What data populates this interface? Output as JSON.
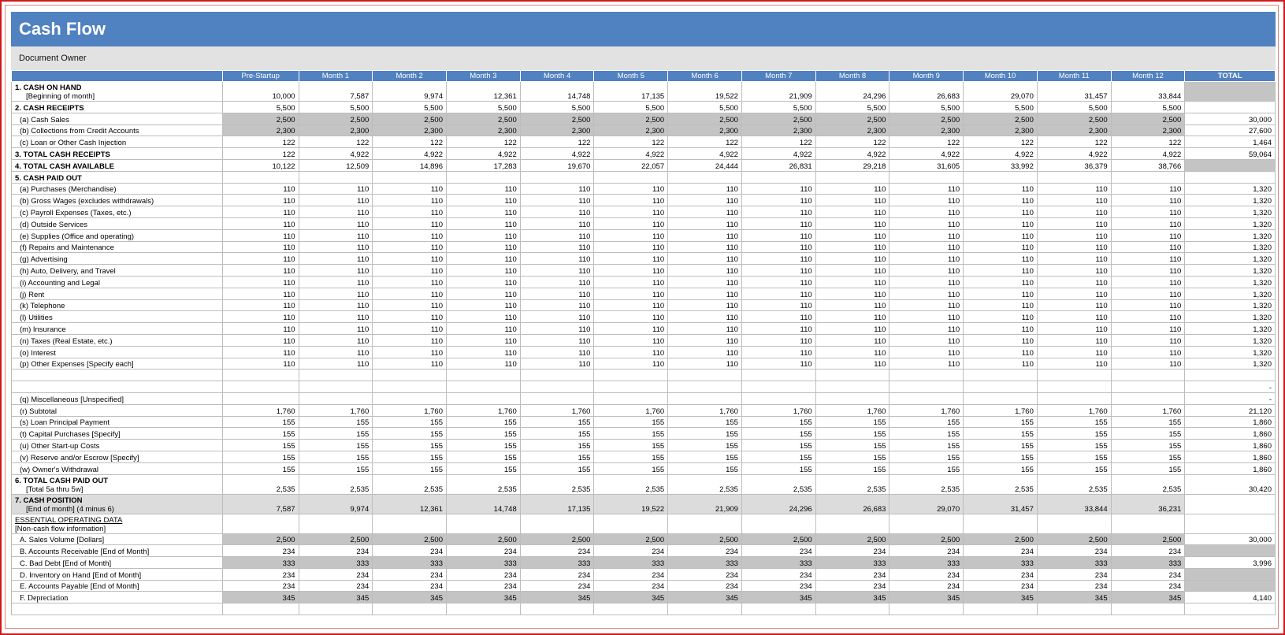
{
  "title": "Cash Flow",
  "owner": "Document Owner",
  "columns": [
    "",
    "Pre-Startup",
    "Month 1",
    "Month 2",
    "Month 3",
    "Month 4",
    "Month 5",
    "Month 6",
    "Month 7",
    "Month 8",
    "Month 9",
    "Month 10",
    "Month 11",
    "Month 12",
    "TOTAL"
  ],
  "rows": [
    {
      "l1": "1. CASH ON HAND",
      "l2": "[Beginning of month]",
      "type": "tall",
      "v": [
        "10,000",
        "7,587",
        "9,974",
        "12,361",
        "14,748",
        "17,135",
        "19,522",
        "21,909",
        "24,296",
        "26,683",
        "29,070",
        "31,457",
        "33,844"
      ],
      "t": "",
      "tgray": true
    },
    {
      "label": "2. CASH RECEIPTS",
      "type": "bold",
      "v": [
        "5,500",
        "5,500",
        "5,500",
        "5,500",
        "5,500",
        "5,500",
        "5,500",
        "5,500",
        "5,500",
        "5,500",
        "5,500",
        "5,500",
        "5,500"
      ],
      "t": ""
    },
    {
      "label": "(a) Cash Sales",
      "type": "shade",
      "ind": true,
      "v": [
        "2,500",
        "2,500",
        "2,500",
        "2,500",
        "2,500",
        "2,500",
        "2,500",
        "2,500",
        "2,500",
        "2,500",
        "2,500",
        "2,500",
        "2,500"
      ],
      "t": "30,000"
    },
    {
      "label": "(b) Collections from Credit Accounts",
      "type": "shade",
      "ind": true,
      "v": [
        "2,300",
        "2,300",
        "2,300",
        "2,300",
        "2,300",
        "2,300",
        "2,300",
        "2,300",
        "2,300",
        "2,300",
        "2,300",
        "2,300",
        "2,300"
      ],
      "t": "27,600"
    },
    {
      "label": "(c) Loan or Other Cash Injection",
      "ind": true,
      "v": [
        "122",
        "122",
        "122",
        "122",
        "122",
        "122",
        "122",
        "122",
        "122",
        "122",
        "122",
        "122",
        "122"
      ],
      "t": "1,464"
    },
    {
      "label": "3. TOTAL CASH RECEIPTS",
      "type": "bold",
      "v": [
        "122",
        "4,922",
        "4,922",
        "4,922",
        "4,922",
        "4,922",
        "4,922",
        "4,922",
        "4,922",
        "4,922",
        "4,922",
        "4,922",
        "4,922"
      ],
      "t": "59,064"
    },
    {
      "label": "4. TOTAL CASH AVAILABLE",
      "type": "bold",
      "v": [
        "10,122",
        "12,509",
        "14,896",
        "17,283",
        "19,670",
        "22,057",
        "24,444",
        "26,831",
        "29,218",
        "31,605",
        "33,992",
        "36,379",
        "38,766"
      ],
      "t": "",
      "tgray": true
    },
    {
      "label": "5. CASH PAID OUT",
      "type": "bold",
      "v": [
        "",
        "",
        "",
        "",
        "",
        "",
        "",
        "",
        "",
        "",
        "",
        "",
        ""
      ],
      "t": ""
    },
    {
      "label": "(a) Purchases (Merchandise)",
      "ind": true,
      "v": [
        "110",
        "110",
        "110",
        "110",
        "110",
        "110",
        "110",
        "110",
        "110",
        "110",
        "110",
        "110",
        "110"
      ],
      "t": "1,320"
    },
    {
      "label": "(b) Gross Wages (excludes withdrawals)",
      "ind": true,
      "v": [
        "110",
        "110",
        "110",
        "110",
        "110",
        "110",
        "110",
        "110",
        "110",
        "110",
        "110",
        "110",
        "110"
      ],
      "t": "1,320"
    },
    {
      "label": "(c) Payroll Expenses (Taxes, etc.)",
      "ind": true,
      "v": [
        "110",
        "110",
        "110",
        "110",
        "110",
        "110",
        "110",
        "110",
        "110",
        "110",
        "110",
        "110",
        "110"
      ],
      "t": "1,320"
    },
    {
      "label": "(d) Outside Services",
      "ind": true,
      "v": [
        "110",
        "110",
        "110",
        "110",
        "110",
        "110",
        "110",
        "110",
        "110",
        "110",
        "110",
        "110",
        "110"
      ],
      "t": "1,320"
    },
    {
      "label": "(e) Supplies (Office and operating)",
      "ind": true,
      "v": [
        "110",
        "110",
        "110",
        "110",
        "110",
        "110",
        "110",
        "110",
        "110",
        "110",
        "110",
        "110",
        "110"
      ],
      "t": "1,320"
    },
    {
      "label": "(f) Repairs and Maintenance",
      "ind": true,
      "v": [
        "110",
        "110",
        "110",
        "110",
        "110",
        "110",
        "110",
        "110",
        "110",
        "110",
        "110",
        "110",
        "110"
      ],
      "t": "1,320"
    },
    {
      "label": "(g) Advertising",
      "ind": true,
      "v": [
        "110",
        "110",
        "110",
        "110",
        "110",
        "110",
        "110",
        "110",
        "110",
        "110",
        "110",
        "110",
        "110"
      ],
      "t": "1,320"
    },
    {
      "label": "(h) Auto, Delivery, and Travel",
      "ind": true,
      "v": [
        "110",
        "110",
        "110",
        "110",
        "110",
        "110",
        "110",
        "110",
        "110",
        "110",
        "110",
        "110",
        "110"
      ],
      "t": "1,320"
    },
    {
      "label": "(i) Accounting and Legal",
      "ind": true,
      "v": [
        "110",
        "110",
        "110",
        "110",
        "110",
        "110",
        "110",
        "110",
        "110",
        "110",
        "110",
        "110",
        "110"
      ],
      "t": "1,320"
    },
    {
      "label": "(j) Rent",
      "ind": true,
      "v": [
        "110",
        "110",
        "110",
        "110",
        "110",
        "110",
        "110",
        "110",
        "110",
        "110",
        "110",
        "110",
        "110"
      ],
      "t": "1,320"
    },
    {
      "label": "(k) Telephone",
      "ind": true,
      "v": [
        "110",
        "110",
        "110",
        "110",
        "110",
        "110",
        "110",
        "110",
        "110",
        "110",
        "110",
        "110",
        "110"
      ],
      "t": "1,320"
    },
    {
      "label": "(l) Utilities",
      "ind": true,
      "v": [
        "110",
        "110",
        "110",
        "110",
        "110",
        "110",
        "110",
        "110",
        "110",
        "110",
        "110",
        "110",
        "110"
      ],
      "t": "1,320"
    },
    {
      "label": "(m) Insurance",
      "ind": true,
      "v": [
        "110",
        "110",
        "110",
        "110",
        "110",
        "110",
        "110",
        "110",
        "110",
        "110",
        "110",
        "110",
        "110"
      ],
      "t": "1,320"
    },
    {
      "label": "(n) Taxes (Real Estate, etc.)",
      "ind": true,
      "v": [
        "110",
        "110",
        "110",
        "110",
        "110",
        "110",
        "110",
        "110",
        "110",
        "110",
        "110",
        "110",
        "110"
      ],
      "t": "1,320"
    },
    {
      "label": "(o) Interest",
      "ind": true,
      "v": [
        "110",
        "110",
        "110",
        "110",
        "110",
        "110",
        "110",
        "110",
        "110",
        "110",
        "110",
        "110",
        "110"
      ],
      "t": "1,320"
    },
    {
      "label": "(p) Other Expenses [Specify each]",
      "ind": true,
      "v": [
        "110",
        "110",
        "110",
        "110",
        "110",
        "110",
        "110",
        "110",
        "110",
        "110",
        "110",
        "110",
        "110"
      ],
      "t": "1,320"
    },
    {
      "label": "",
      "v": [
        "",
        "",
        "",
        "",
        "",
        "",
        "",
        "",
        "",
        "",
        "",
        "",
        ""
      ],
      "t": ""
    },
    {
      "label": "",
      "v": [
        "",
        "",
        "",
        "",
        "",
        "",
        "",
        "",
        "",
        "",
        "",
        "",
        ""
      ],
      "t": "-"
    },
    {
      "label": "(q) Miscellaneous [Unspecified]",
      "ind": true,
      "v": [
        "",
        "",
        "",
        "",
        "",
        "",
        "",
        "",
        "",
        "",
        "",
        "",
        ""
      ],
      "t": "-"
    },
    {
      "label": "(r) Subtotal",
      "ind": true,
      "v": [
        "1,760",
        "1,760",
        "1,760",
        "1,760",
        "1,760",
        "1,760",
        "1,760",
        "1,760",
        "1,760",
        "1,760",
        "1,760",
        "1,760",
        "1,760"
      ],
      "t": "21,120"
    },
    {
      "label": "(s) Loan Principal Payment",
      "ind": true,
      "v": [
        "155",
        "155",
        "155",
        "155",
        "155",
        "155",
        "155",
        "155",
        "155",
        "155",
        "155",
        "155",
        "155"
      ],
      "t": "1,860"
    },
    {
      "label": "(t) Capital Purchases [Specify]",
      "ind": true,
      "v": [
        "155",
        "155",
        "155",
        "155",
        "155",
        "155",
        "155",
        "155",
        "155",
        "155",
        "155",
        "155",
        "155"
      ],
      "t": "1,860"
    },
    {
      "label": "(u) Other Start-up Costs",
      "ind": true,
      "v": [
        "155",
        "155",
        "155",
        "155",
        "155",
        "155",
        "155",
        "155",
        "155",
        "155",
        "155",
        "155",
        "155"
      ],
      "t": "1,860"
    },
    {
      "label": "(v) Reserve and/or Escrow [Specify]",
      "ind": true,
      "v": [
        "155",
        "155",
        "155",
        "155",
        "155",
        "155",
        "155",
        "155",
        "155",
        "155",
        "155",
        "155",
        "155"
      ],
      "t": "1,860"
    },
    {
      "label": "(w) Owner's Withdrawal",
      "ind": true,
      "v": [
        "155",
        "155",
        "155",
        "155",
        "155",
        "155",
        "155",
        "155",
        "155",
        "155",
        "155",
        "155",
        "155"
      ],
      "t": "1,860"
    },
    {
      "l1": "6. TOTAL CASH PAID OUT",
      "l2": "[Total 5a thru 5w]",
      "type": "tall",
      "v": [
        "2,535",
        "2,535",
        "2,535",
        "2,535",
        "2,535",
        "2,535",
        "2,535",
        "2,535",
        "2,535",
        "2,535",
        "2,535",
        "2,535",
        "2,535"
      ],
      "t": "30,420"
    },
    {
      "l1": "7. CASH POSITION",
      "l2": "[End of month]  (4 minus 6)",
      "type": "tall pos",
      "v": [
        "7,587",
        "9,974",
        "12,361",
        "14,748",
        "17,135",
        "19,522",
        "21,909",
        "24,296",
        "26,683",
        "29,070",
        "31,457",
        "33,844",
        "36,231"
      ],
      "t": "",
      "twhite": true
    },
    {
      "l1": "ESSENTIAL OPERATING DATA",
      "l2": "[Non-cash flow information]",
      "type": "tall essential",
      "v": [
        "",
        "",
        "",
        "",
        "",
        "",
        "",
        "",
        "",
        "",
        "",
        "",
        ""
      ],
      "t": ""
    },
    {
      "label": "A. Sales Volume [Dollars]",
      "type": "shade",
      "ind": true,
      "v": [
        "2,500",
        "2,500",
        "2,500",
        "2,500",
        "2,500",
        "2,500",
        "2,500",
        "2,500",
        "2,500",
        "2,500",
        "2,500",
        "2,500",
        "2,500"
      ],
      "t": "30,000"
    },
    {
      "label": "B. Accounts Receivable [End of Month]",
      "ind": true,
      "v": [
        "234",
        "234",
        "234",
        "234",
        "234",
        "234",
        "234",
        "234",
        "234",
        "234",
        "234",
        "234",
        "234"
      ],
      "t": "",
      "tgray": true
    },
    {
      "label": "C. Bad Debt [End of Month]",
      "type": "shade",
      "ind": true,
      "v": [
        "333",
        "333",
        "333",
        "333",
        "333",
        "333",
        "333",
        "333",
        "333",
        "333",
        "333",
        "333",
        "333"
      ],
      "t": "3,996"
    },
    {
      "label": "D. Inventory on Hand [End of Month]",
      "ind": true,
      "v": [
        "234",
        "234",
        "234",
        "234",
        "234",
        "234",
        "234",
        "234",
        "234",
        "234",
        "234",
        "234",
        "234"
      ],
      "t": "",
      "tgray": true
    },
    {
      "label": "E. Accounts Payable [End of Month]",
      "ind": true,
      "v": [
        "234",
        "234",
        "234",
        "234",
        "234",
        "234",
        "234",
        "234",
        "234",
        "234",
        "234",
        "234",
        "234"
      ],
      "t": "",
      "tgray": true
    },
    {
      "label": "F. Depreciation",
      "type": "shade serifrow",
      "ind": true,
      "v": [
        "345",
        "345",
        "345",
        "345",
        "345",
        "345",
        "345",
        "345",
        "345",
        "345",
        "345",
        "345",
        "345"
      ],
      "t": "4,140"
    },
    {
      "label": "",
      "v": [
        "",
        "",
        "",
        "",
        "",
        "",
        "",
        "",
        "",
        "",
        "",
        "",
        ""
      ],
      "t": ""
    }
  ]
}
